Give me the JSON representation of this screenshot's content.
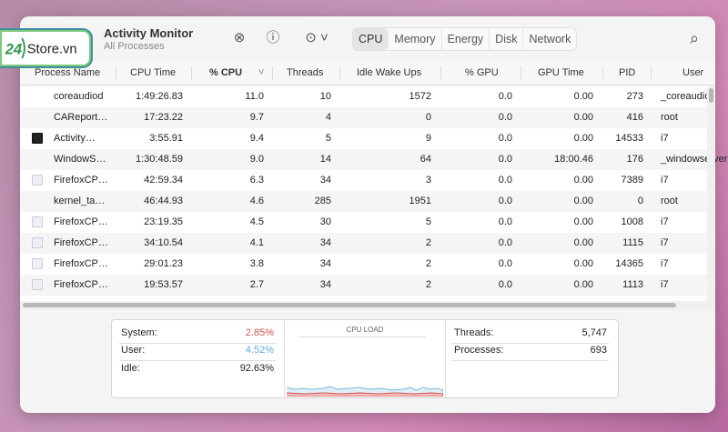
{
  "window": {
    "title": "Activity Monitor",
    "subtitle": "All Processes"
  },
  "toolbar": {
    "stop_icon": "x-circle-icon",
    "info_icon": "info-icon",
    "more_icon": "ellipsis-icon",
    "search_icon": "search-icon"
  },
  "tabs": [
    "CPU",
    "Memory",
    "Energy",
    "Disk",
    "Network"
  ],
  "active_tab": "CPU",
  "columns": [
    "Process Name",
    "CPU Time",
    "% CPU",
    "Threads",
    "Idle Wake Ups",
    "% GPU",
    "GPU Time",
    "PID",
    "User"
  ],
  "rows": [
    [
      "coreaudiod",
      "1:49:26.83",
      "11.0",
      "10",
      "1572",
      "0.0",
      "0.00",
      "273",
      "_coreaudiod"
    ],
    [
      "CAReport…",
      "17:23.22",
      "9.7",
      "4",
      "0",
      "0.0",
      "0.00",
      "416",
      "root"
    ],
    [
      "Activity…",
      "3:55.91",
      "9.4",
      "5",
      "9",
      "0.0",
      "0.00",
      "14533",
      "i7"
    ],
    [
      "WindowS…",
      "1:30:48.59",
      "9.0",
      "14",
      "64",
      "0.0",
      "18:00.46",
      "176",
      "_windowserver"
    ],
    [
      "FirefoxCP…",
      "42:59.34",
      "6.3",
      "34",
      "3",
      "0.0",
      "0.00",
      "7389",
      "i7"
    ],
    [
      "kernel_ta…",
      "46:44.93",
      "4.6",
      "285",
      "1951",
      "0.0",
      "0.00",
      "0",
      "root"
    ],
    [
      "FirefoxCP…",
      "23:19.35",
      "4.5",
      "30",
      "5",
      "0.0",
      "0.00",
      "1008",
      "i7"
    ],
    [
      "FirefoxCP…",
      "34:10.54",
      "4.1",
      "34",
      "2",
      "0.0",
      "0.00",
      "1115",
      "i7"
    ],
    [
      "FirefoxCP…",
      "29:01.23",
      "3.8",
      "34",
      "2",
      "0.0",
      "0.00",
      "14365",
      "i7"
    ],
    [
      "FirefoxCP…",
      "19:53.57",
      "2.7",
      "34",
      "2",
      "0.0",
      "0.00",
      "1113",
      "i7"
    ]
  ],
  "row_icons": [
    "none",
    "none",
    "activity",
    "none",
    "doc",
    "none",
    "doc",
    "doc",
    "doc",
    "doc"
  ],
  "stats": {
    "system_label": "System:",
    "system": "2.85%",
    "user_label": "User:",
    "user": "4.52%",
    "idle_label": "Idle:",
    "idle": "92.63%",
    "chart_title": "CPU LOAD",
    "threads_label": "Threads:",
    "threads": "5,747",
    "processes_label": "Processes:",
    "processes": "693"
  },
  "colors": {
    "system": "#d9534f",
    "user": "#5aaed6"
  },
  "logo": {
    "text": "24Store.vn"
  }
}
